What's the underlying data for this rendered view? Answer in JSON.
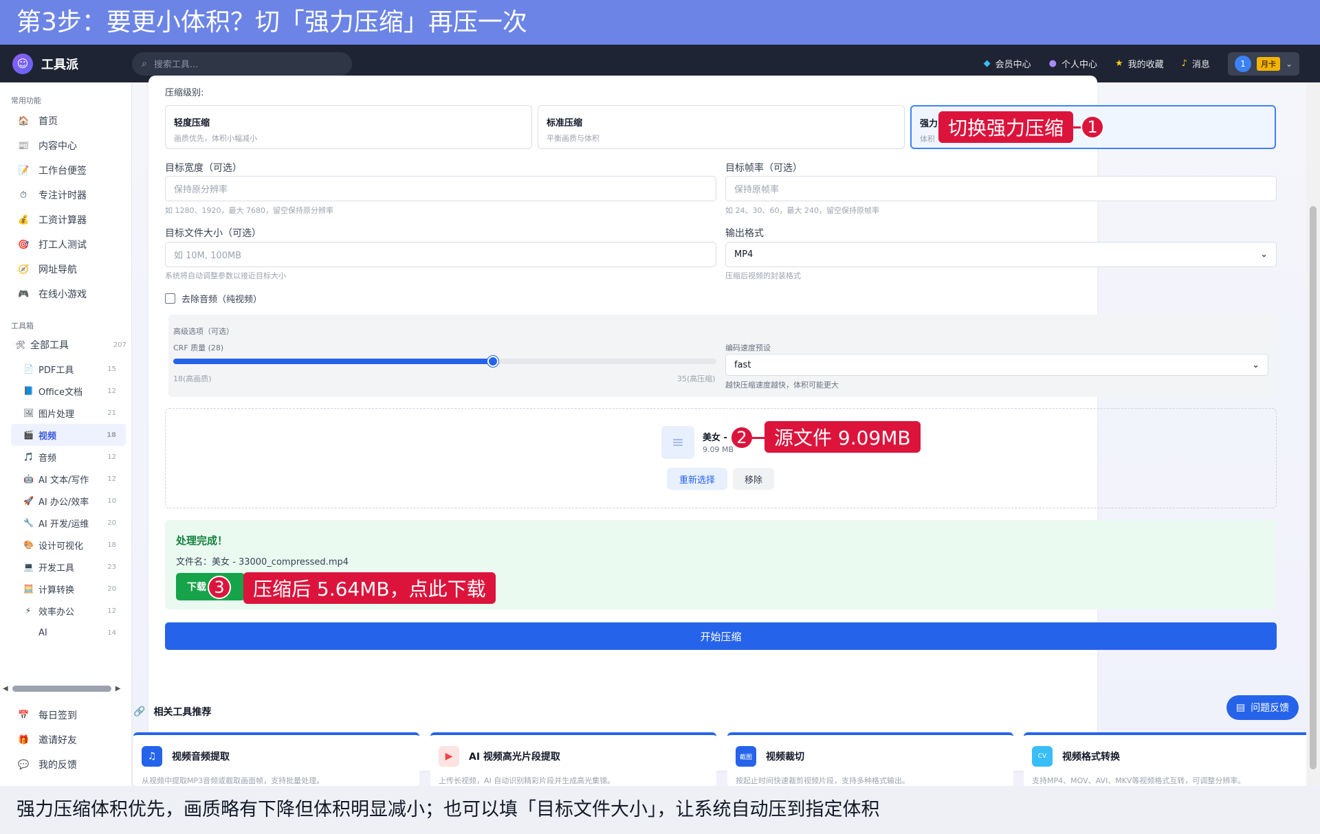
{
  "banner_top": "第3步：要更小体积？切「强力压缩」再压一次",
  "banner_bottom": "强力压缩体积优先，画质略有下降但体积明显减小；也可以填「目标文件大小」，让系统自动压到指定体积",
  "header": {
    "app_name": "工具派",
    "search_placeholder": "搜索工具...",
    "items": [
      "会员中心",
      "个人中心",
      "我的收藏",
      "消息"
    ],
    "user_num": "1",
    "card_label": "月卡"
  },
  "sidebar": {
    "section_common": "常用功能",
    "common": [
      {
        "label": "首页",
        "icon": "🏠"
      },
      {
        "label": "内容中心",
        "icon": "📰"
      },
      {
        "label": "工作台便签",
        "icon": "📝"
      },
      {
        "label": "专注计时器",
        "icon": "⏱"
      },
      {
        "label": "工资计算器",
        "icon": "💰"
      },
      {
        "label": "打工人测试",
        "icon": "🎯"
      },
      {
        "label": "网址导航",
        "icon": "🧭"
      },
      {
        "label": "在线小游戏",
        "icon": "🎮"
      }
    ],
    "section_tools": "工具箱",
    "all_tools": {
      "label": "全部工具",
      "count": "207"
    },
    "categories": [
      {
        "label": "PDF工具",
        "count": "15",
        "icon": "📄"
      },
      {
        "label": "Office文档",
        "count": "12",
        "icon": "📘"
      },
      {
        "label": "图片处理",
        "count": "21",
        "icon": "🖼"
      },
      {
        "label": "视频",
        "count": "18",
        "icon": "🎬"
      },
      {
        "label": "音频",
        "count": "12",
        "icon": "🎵"
      },
      {
        "label": "AI 文本/写作",
        "count": "12",
        "icon": "🤖"
      },
      {
        "label": "AI 办公/效率",
        "count": "10",
        "icon": "🚀"
      },
      {
        "label": "AI 开发/运维",
        "count": "20",
        "icon": "🔧"
      },
      {
        "label": "设计可视化",
        "count": "18",
        "icon": "🎨"
      },
      {
        "label": "开发工具",
        "count": "23",
        "icon": "💻"
      },
      {
        "label": "计算转换",
        "count": "20",
        "icon": "🧮"
      },
      {
        "label": "效率办公",
        "count": "12",
        "icon": "⚡"
      },
      {
        "label": "AI",
        "count": "14",
        "icon": ""
      }
    ],
    "bottom": [
      {
        "label": "每日签到",
        "icon": "📅"
      },
      {
        "label": "邀请好友",
        "icon": "🎁"
      },
      {
        "label": "我的反馈",
        "icon": "💬"
      }
    ]
  },
  "form": {
    "level_label": "压缩级别:",
    "levels": [
      {
        "title": "轻度压缩",
        "desc": "画质优先，体积小幅减小"
      },
      {
        "title": "标准压缩",
        "desc": "平衡画质与体积"
      },
      {
        "title": "强力",
        "desc": "体积"
      }
    ],
    "width_label": "目标宽度（可选）",
    "width_placeholder": "保持原分辨率",
    "width_hint": "如 1280、1920，最大 7680，留空保持原分辨率",
    "fps_label": "目标帧率（可选）",
    "fps_placeholder": "保持原帧率",
    "fps_hint": "如 24、30、60，最大 240，留空保持原帧率",
    "size_label": "目标文件大小（可选）",
    "size_placeholder": "如 10M, 100MB",
    "size_hint": "系统将自动调整参数以接近目标大小",
    "format_label": "输出格式",
    "format_value": "MP4",
    "format_hint": "压缩后视频的封装格式",
    "remove_audio": "去除音频（纯视频）",
    "advanced_label": "高级选项（可选）",
    "crf_label": "CRF 质量 (28)",
    "crf_value": 28,
    "crf_min": 18,
    "crf_max": 35,
    "crf_min_label": "18(高画质)",
    "crf_max_label": "35(高压缩)",
    "preset_label": "编码速度预设",
    "preset_value": "fast",
    "preset_hint": "越快压缩速度越快，体积可能更大"
  },
  "upload": {
    "file_name": "美女 -",
    "file_size": "9.09 MB",
    "reselect": "重新选择",
    "remove": "移除"
  },
  "result": {
    "title": "处理完成！",
    "filename": "文件名：美女 - 33000_compressed.mp4",
    "download": "下载"
  },
  "start_button": "开始压缩",
  "related": {
    "title": "相关工具推荐",
    "cards": [
      {
        "title": "视频音频提取",
        "desc": "从视频中提取MP3音频或截取画面帧，支持批量处理。",
        "icon": "♫",
        "color": "#2563eb"
      },
      {
        "title": "AI 视频高光片段提取",
        "desc": "上传长视频，AI 自动识别精彩片段并生成高光集锦。",
        "icon": "▶",
        "color": "#fde2e2"
      },
      {
        "title": "视频裁切",
        "desc": "按起止时间快速裁剪视频片段，支持多种格式输出。",
        "icon": "截图",
        "color": "#2563eb"
      },
      {
        "title": "视频格式转换",
        "desc": "支持MP4、MOV、AVI、MKV等视频格式互转，可调整分辨率。",
        "icon": "CV",
        "color": "#38bdf8"
      }
    ]
  },
  "feedback": "问题反馈",
  "callouts": {
    "c1": "切换强力压缩",
    "c2": "源文件 9.09MB",
    "c3": "压缩后 5.64MB，点此下载",
    "n1": "1",
    "n2": "2",
    "n3": "3"
  }
}
